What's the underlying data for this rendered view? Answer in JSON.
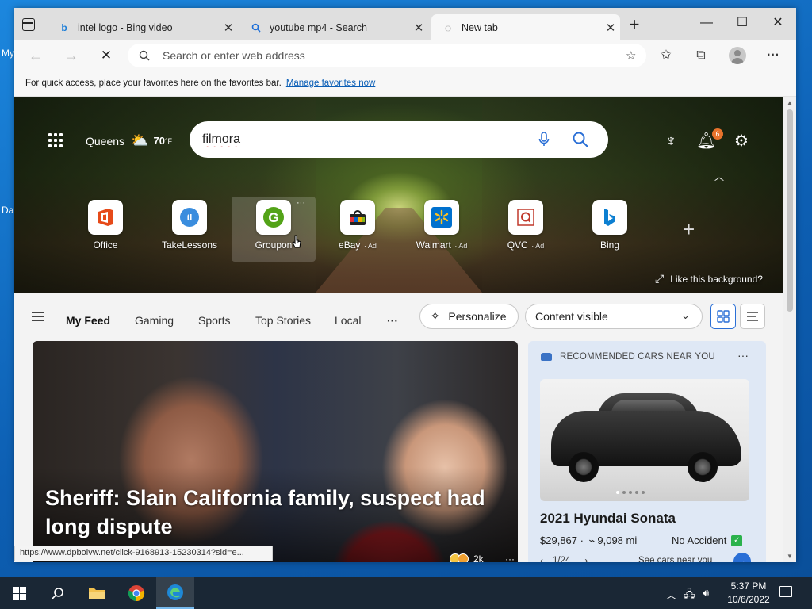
{
  "desktop": {
    "frag1": "My",
    "frag2": "Da"
  },
  "browser": {
    "tabs": [
      {
        "title": "intel logo - Bing video",
        "favicon": "bing-icon"
      },
      {
        "title": "youtube mp4 - Search",
        "favicon": "search-icon"
      },
      {
        "title": "New tab",
        "favicon": "loading-icon"
      }
    ],
    "window_controls": [
      "minimize",
      "maximize",
      "close"
    ],
    "address": {
      "placeholder": "Search or enter web address",
      "value": ""
    },
    "favorites_bar": {
      "message": "For quick access, place your favorites here on the favorites bar.",
      "link": "Manage favorites now"
    }
  },
  "newtab": {
    "weather": {
      "location": "Queens",
      "temp": "70",
      "unit": "°F",
      "icon": "partly-cloudy-icon"
    },
    "search": {
      "value": "filmora"
    },
    "notification_count": "6",
    "quick_links": [
      {
        "label": "Office",
        "ad": "",
        "icon": "office-icon",
        "color": "#e64a19"
      },
      {
        "label": "TakeLessons",
        "ad": "",
        "icon": "takelessons-icon",
        "color": "#3a8dde"
      },
      {
        "label": "Groupon",
        "ad": "",
        "icon": "groupon-icon",
        "color": "#53a318"
      },
      {
        "label": "eBay",
        "ad": "Ad",
        "icon": "ebay-icon",
        "color": "#e53238"
      },
      {
        "label": "Walmart",
        "ad": "Ad",
        "icon": "walmart-icon",
        "color": "#0071ce"
      },
      {
        "label": "QVC",
        "ad": "Ad",
        "icon": "qvc-icon",
        "color": "#c0392b"
      },
      {
        "label": "Bing",
        "ad": "",
        "icon": "bing-icon",
        "color": "#0c7fd1"
      }
    ],
    "like_background": "Like this background?"
  },
  "feed": {
    "tabs": [
      "My Feed",
      "Gaming",
      "Sports",
      "Top Stories",
      "Local"
    ],
    "personalize": "Personalize",
    "content_visibility": "Content visible",
    "main_story": {
      "headline": "Sheriff: Slain California family, suspect had long dispute",
      "reactions": "2k"
    },
    "side_card": {
      "header": "RECOMMENDED CARS NEAR YOU",
      "title": "2021 Hyundai Sonata",
      "price": "$29,867 · ",
      "mileage": "9,098 mi",
      "status": "No Accident",
      "pager": "1/24",
      "cta": "See cars near you"
    }
  },
  "status_url": "https://www.dpbolvw.net/click-9168913-15230314?sid=e...",
  "taskbar": {
    "time": "5:37 PM",
    "date": "10/6/2022"
  }
}
